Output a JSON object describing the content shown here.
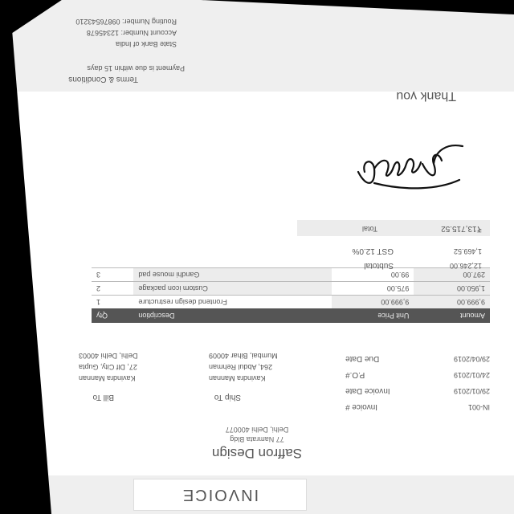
{
  "invoice": {
    "title": "INVOICE",
    "company": "Saffron Design",
    "address_line1": "77 Namrata Bldg",
    "address_line2": "Delhi, Delhi 400077",
    "bill_to_label": "Bill To",
    "bill_to": [
      "Kavindra Mannan",
      "27, Dlf City, Gupta",
      "Delhi, Delhi 40003"
    ],
    "ship_to_label": "Ship To",
    "ship_to": [
      "Kavindra Mannan",
      "264, Abdul Rehman",
      "Mumbai, Bihar 40009"
    ],
    "meta": [
      {
        "label": "Invoice #",
        "value": "IN-001"
      },
      {
        "label": "Invoice Date",
        "value": "29/01/2019"
      },
      {
        "label": "P.O.#",
        "value": "24/01/2019"
      },
      {
        "label": "Due Date",
        "value": "29/04/2019"
      }
    ],
    "table_headers": {
      "qty": "Qty",
      "description": "Description",
      "unit_price": "Unit Price",
      "amount": "Amount"
    },
    "items": [
      {
        "qty": "1",
        "description": "Frontend design restructure",
        "unit_price": "9,999.00",
        "amount": "9,999.00"
      },
      {
        "qty": "2",
        "description": "Custom icon package",
        "unit_price": "975.00",
        "amount": "1,950.00"
      },
      {
        "qty": "3",
        "description": "Gandhi mouse pad",
        "unit_price": "99.00",
        "amount": "297.00"
      }
    ],
    "subtotal_label": "Subtotal",
    "subtotal": "12,246.00",
    "gst_label": "GST 12.0%",
    "gst": "1,469.52",
    "total_label": "Total",
    "total": "₹13,715.52",
    "thanks": "Thank you",
    "terms_heading": "Terms & Conditions",
    "terms_text": "Payment is due within 15 days",
    "bank": [
      "State Bank of India",
      "Account Number: 12345678",
      "Routing Number: 09876543210"
    ]
  }
}
